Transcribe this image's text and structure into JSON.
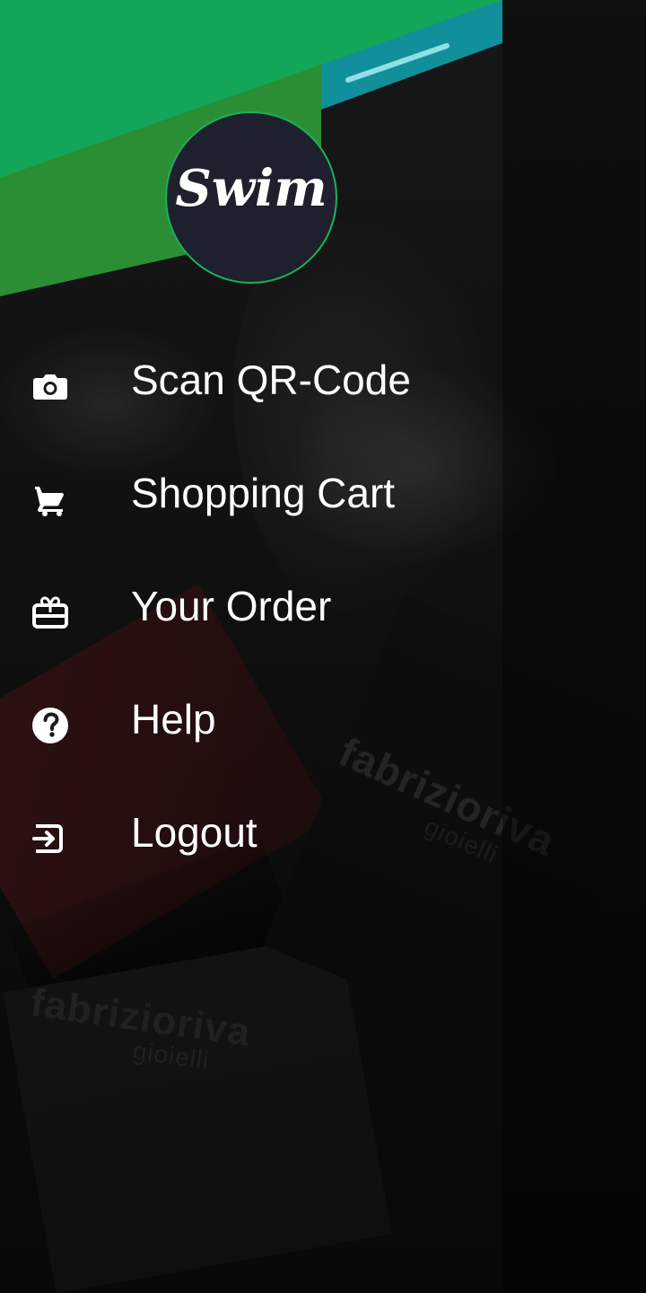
{
  "drawer": {
    "brand": "Swim",
    "items": [
      {
        "label": "Scan QR-Code",
        "icon": "camera-icon"
      },
      {
        "label": "Shopping Cart",
        "icon": "cart-icon"
      },
      {
        "label": "Your Order",
        "icon": "gift-icon"
      },
      {
        "label": "Help",
        "icon": "help-icon"
      },
      {
        "label": "Logout",
        "icon": "logout-icon"
      }
    ]
  },
  "background": {
    "watermark_main": "fabrizioriva",
    "watermark_sub": "gioielli"
  },
  "colors": {
    "accent_green": "#18b35b",
    "accent_dark_green": "#2d8a34",
    "accent_blue": "#0f8f98",
    "avatar_bg": "#1f202d",
    "menu_text": "#ffffff"
  }
}
